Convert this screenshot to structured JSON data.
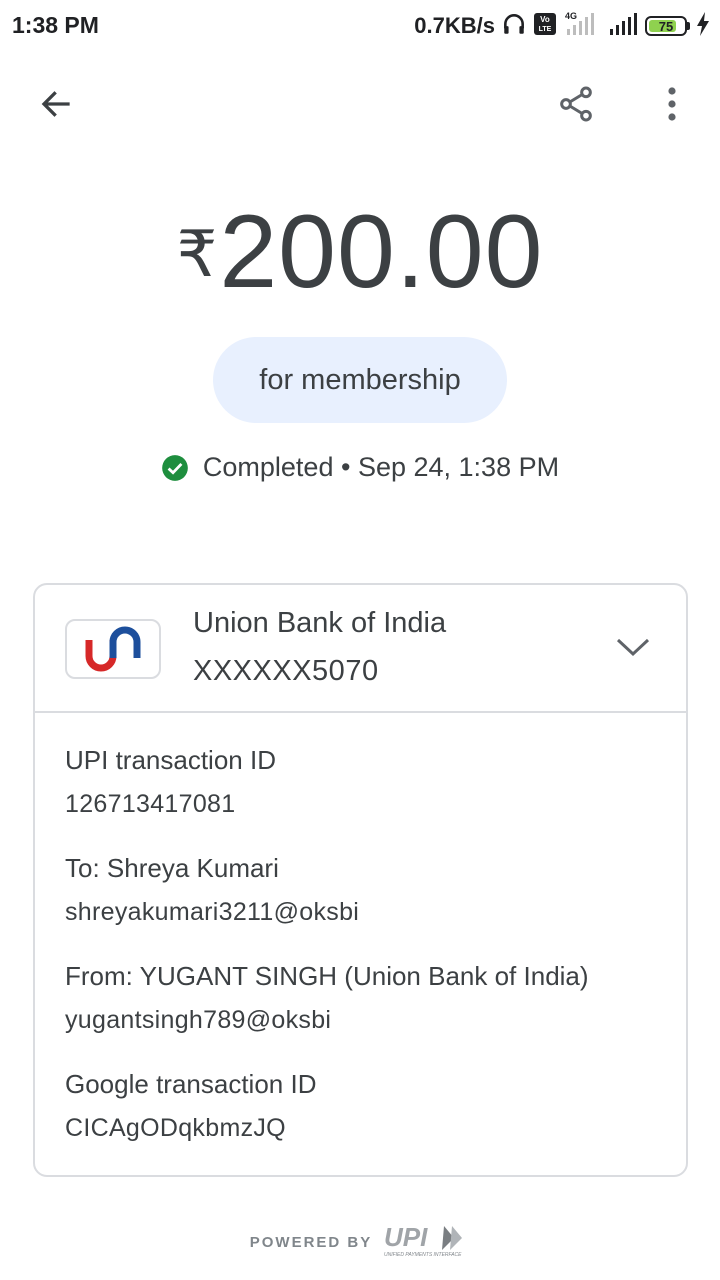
{
  "status_bar": {
    "time": "1:38 PM",
    "net_speed": "0.7KB/s",
    "network_type": "4G",
    "volte_label": "Vo LTE",
    "battery_level": "75",
    "icons": [
      "headphones-icon",
      "volte-icon",
      "signal-icon",
      "charging-icon"
    ]
  },
  "app_bar": {
    "icons": [
      "back-arrow-icon",
      "share-icon",
      "more-vert-icon"
    ]
  },
  "transaction": {
    "currency_symbol": "₹",
    "amount": "200.00",
    "note": "for membership",
    "status": "Completed",
    "separator": "•",
    "datetime": "Sep 24, 1:38 PM"
  },
  "bank": {
    "name": "Union Bank of India",
    "account": "XXXXXX5070"
  },
  "details": [
    {
      "label": "UPI transaction ID",
      "value": "126713417081"
    },
    {
      "label": "To: Shreya  Kumari",
      "value": "shreyakumari3211@oksbi"
    },
    {
      "label": "From: YUGANT SINGH (Union Bank of India)",
      "value": "yugantsingh789@oksbi"
    },
    {
      "label": "Google transaction ID",
      "value": "CICAgODqkbmzJQ"
    }
  ],
  "footer": {
    "powered_by": "POWERED BY",
    "upi_logo_text": "UPI",
    "upi_tagline": "UNIFIED PAYMENTS INTERFACE"
  },
  "colors": {
    "text": "#3c4043",
    "pill_bg": "#e8f0fe",
    "success_green": "#1e8e3e",
    "divider": "#dadce0",
    "union_red": "#d62828",
    "union_blue": "#1d4f9c"
  }
}
